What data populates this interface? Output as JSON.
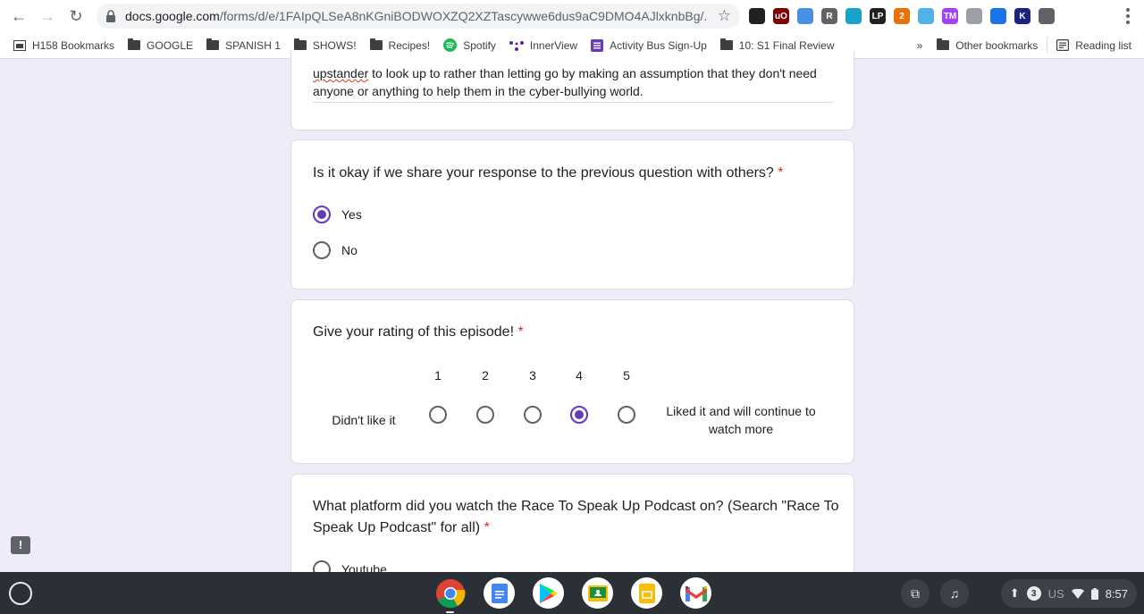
{
  "browser": {
    "url_host": "docs.google.com",
    "url_path": "/forms/d/e/1FAIpQLSeA8nKGniBODWOXZQ2XZTascywwe6dus9aC9DMO4AJlxknbBg/...",
    "extensions": [
      {
        "name": "ninja-extension-icon",
        "label": "",
        "color": "#202124"
      },
      {
        "name": "ublock-origin-icon",
        "label": "uO",
        "color": "#800000"
      },
      {
        "name": "pin-extension-icon",
        "label": "",
        "color": "#4a90e2"
      },
      {
        "name": "r-extension-icon",
        "label": "R",
        "color": "#5f6368"
      },
      {
        "name": "globe-extension-icon",
        "label": "",
        "color": "#1aa3c9"
      },
      {
        "name": "lp-extension-icon",
        "label": "LP",
        "color": "#202124"
      },
      {
        "name": "puzzle-extension-icon",
        "label": "2",
        "color": "#e8710a"
      },
      {
        "name": "cloud-extension-icon",
        "label": "",
        "color": "#4fb3e8"
      },
      {
        "name": "tm-extension-icon",
        "label": "TM",
        "color": "#a142f4"
      },
      {
        "name": "copy-extension-icon",
        "label": "",
        "color": "#9aa0a6"
      },
      {
        "name": "pointer-extension-icon",
        "label": "",
        "color": "#1a73e8"
      },
      {
        "name": "k-extension-icon",
        "label": "K",
        "color": "#1a237e"
      },
      {
        "name": "extensions-puzzle-icon",
        "label": "",
        "color": "#5f6368"
      }
    ]
  },
  "bookmarks": {
    "items": [
      "H158 Bookmarks",
      "GOOGLE",
      "SPANISH 1",
      "SHOWS!",
      "Recipes!",
      "Spotify",
      "InnerView",
      "Activity Bus Sign-Up",
      "10: S1 Final Review"
    ],
    "overflow": "»",
    "other": "Other bookmarks",
    "reading_list": "Reading list"
  },
  "form": {
    "previous_answer_pre": "upstander",
    "previous_answer_rest": " to look up to rather than letting go by making an assumption that they don't need anyone or anything to help them in the cyber-bullying world.",
    "q_share": {
      "text": "Is it okay if we share your response to the previous question with others?",
      "required": "*",
      "options": [
        "Yes",
        "No"
      ],
      "selected": "Yes"
    },
    "q_rating": {
      "text": "Give your rating of this episode!",
      "required": "*",
      "scale": [
        "1",
        "2",
        "3",
        "4",
        "5"
      ],
      "low_label": "Didn't like it",
      "high_label": "Liked it and will continue to watch more",
      "selected": 4
    },
    "q_platform": {
      "text": "What platform did you watch the Race To Speak Up Podcast on? (Search \"Race To Speak Up Podcast\" for all)",
      "required": "*",
      "first_option": "Youtube"
    }
  },
  "shelf": {
    "apps": [
      "chrome-app-icon",
      "docs-app-icon",
      "play-store-app-icon",
      "classroom-app-icon",
      "slides-app-icon",
      "gmail-app-icon"
    ],
    "notification_count": "3",
    "locale": "US",
    "time": "8:57"
  }
}
